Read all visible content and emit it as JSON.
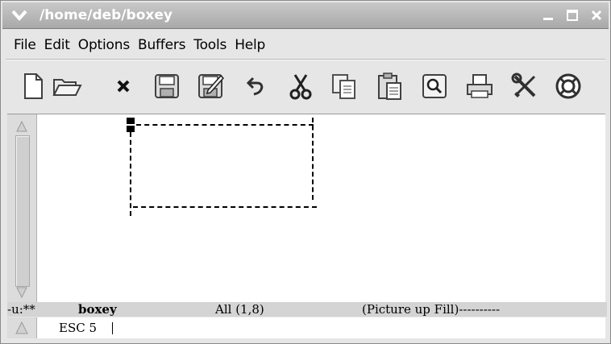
{
  "window": {
    "title": "/home/deb/boxey"
  },
  "menubar": {
    "items": [
      "File",
      "Edit",
      "Options",
      "Buffers",
      "Tools",
      "Help"
    ]
  },
  "toolbar": {
    "buttons": [
      {
        "icon": "new-file-icon"
      },
      {
        "icon": "open-folder-icon"
      },
      {
        "icon": "close-buffer-icon"
      },
      {
        "icon": "save-icon"
      },
      {
        "icon": "save-as-icon"
      },
      {
        "icon": "undo-icon"
      },
      {
        "icon": "cut-icon"
      },
      {
        "icon": "copy-icon"
      },
      {
        "icon": "paste-icon"
      },
      {
        "icon": "search-icon"
      },
      {
        "icon": "print-icon"
      },
      {
        "icon": "customize-icon"
      },
      {
        "icon": "help-icon"
      }
    ]
  },
  "modeline": {
    "status": "-u:**",
    "buffer": "boxey",
    "position": "All (1,8)",
    "mode": "(Picture up Fill)----------"
  },
  "minibuffer": {
    "text": "ESC 5"
  },
  "colors": {
    "titlebar": "#b5b5b5",
    "background": "#e6e6e6",
    "editor": "#ffffff"
  }
}
